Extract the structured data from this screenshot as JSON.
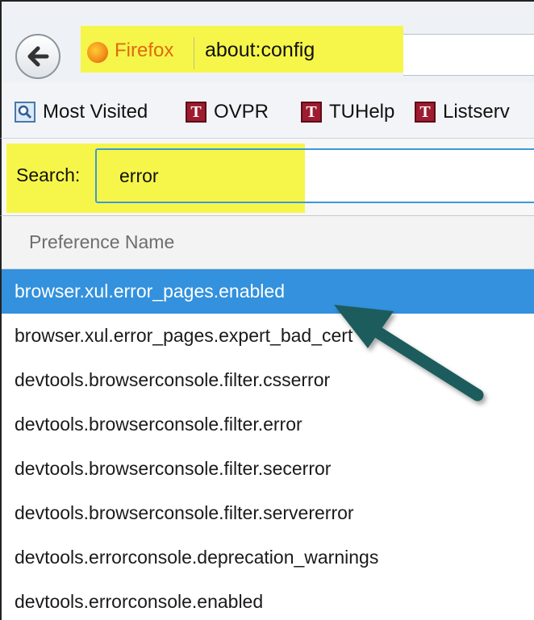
{
  "browser": {
    "identity_label": "Firefox",
    "url": "about:config"
  },
  "bookmarks": [
    {
      "label": "Most Visited",
      "icon": "most-visited-icon"
    },
    {
      "label": "OVPR",
      "icon": "temple-t-icon"
    },
    {
      "label": "TUHelp",
      "icon": "temple-t-icon"
    },
    {
      "label": "Listserv",
      "icon": "temple-t-icon"
    }
  ],
  "search": {
    "label": "Search:",
    "value": "error"
  },
  "table": {
    "column_header": "Preference Name",
    "rows": [
      {
        "name": "browser.xul.error_pages.enabled",
        "selected": true
      },
      {
        "name": "browser.xul.error_pages.expert_bad_cert",
        "selected": false
      },
      {
        "name": "devtools.browserconsole.filter.csserror",
        "selected": false
      },
      {
        "name": "devtools.browserconsole.filter.error",
        "selected": false
      },
      {
        "name": "devtools.browserconsole.filter.secerror",
        "selected": false
      },
      {
        "name": "devtools.browserconsole.filter.servererror",
        "selected": false
      },
      {
        "name": "devtools.errorconsole.deprecation_warnings",
        "selected": false
      },
      {
        "name": "devtools.errorconsole.enabled",
        "selected": false
      }
    ]
  },
  "colors": {
    "highlight": "#f6f64a",
    "selection": "#3391dd",
    "arrow": "#1f5c5c",
    "temple_red": "#9d1c2f"
  }
}
